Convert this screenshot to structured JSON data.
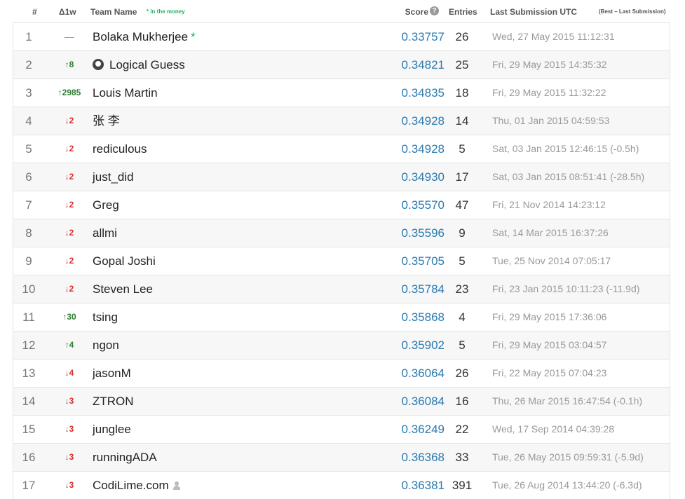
{
  "header": {
    "rank": "#",
    "delta": "Δ1w",
    "team": "Team Name",
    "money_note": "* in the money",
    "score": "Score",
    "help_icon": "?",
    "entries": "Entries",
    "last": "Last Submission UTC",
    "last_note": "(Best – Last Submission)"
  },
  "rows": [
    {
      "rank": "1",
      "delta": "—",
      "dir": "same",
      "team": "Bolaka Mukherjee",
      "star": "*",
      "score": "0.33757",
      "entries": "26",
      "last": "Wed, 27 May 2015 11:12:31"
    },
    {
      "rank": "2",
      "delta": "↑8",
      "dir": "up",
      "team": "Logical Guess",
      "github": true,
      "score": "0.34821",
      "entries": "25",
      "last": "Fri, 29 May 2015 14:35:32"
    },
    {
      "rank": "3",
      "delta": "↑2985",
      "dir": "up",
      "team": "Louis Martin",
      "score": "0.34835",
      "entries": "18",
      "last": "Fri, 29 May 2015 11:32:22"
    },
    {
      "rank": "4",
      "delta": "↓2",
      "dir": "down",
      "team": "张 李",
      "score": "0.34928",
      "entries": "14",
      "last": "Thu, 01 Jan 2015 04:59:53"
    },
    {
      "rank": "5",
      "delta": "↓2",
      "dir": "down",
      "team": "rediculous",
      "score": "0.34928",
      "entries": "5",
      "last": "Sat, 03 Jan 2015 12:46:15 (-0.5h)"
    },
    {
      "rank": "6",
      "delta": "↓2",
      "dir": "down",
      "team": "just_did",
      "score": "0.34930",
      "entries": "17",
      "last": "Sat, 03 Jan 2015 08:51:41 (-28.5h)"
    },
    {
      "rank": "7",
      "delta": "↓2",
      "dir": "down",
      "team": "Greg",
      "score": "0.35570",
      "entries": "47",
      "last": "Fri, 21 Nov 2014 14:23:12"
    },
    {
      "rank": "8",
      "delta": "↓2",
      "dir": "down",
      "team": "allmi",
      "score": "0.35596",
      "entries": "9",
      "last": "Sat, 14 Mar 2015 16:37:26"
    },
    {
      "rank": "9",
      "delta": "↓2",
      "dir": "down",
      "team": "Gopal Joshi",
      "score": "0.35705",
      "entries": "5",
      "last": "Tue, 25 Nov 2014 07:05:17"
    },
    {
      "rank": "10",
      "delta": "↓2",
      "dir": "down",
      "team": "Steven Lee",
      "score": "0.35784",
      "entries": "23",
      "last": "Fri, 23 Jan 2015 10:11:23 (-11.9d)"
    },
    {
      "rank": "11",
      "delta": "↑30",
      "dir": "up",
      "team": "tsing",
      "score": "0.35868",
      "entries": "4",
      "last": "Fri, 29 May 2015 17:36:06"
    },
    {
      "rank": "12",
      "delta": "↑4",
      "dir": "up",
      "team": "ngon",
      "score": "0.35902",
      "entries": "5",
      "last": "Fri, 29 May 2015 03:04:57"
    },
    {
      "rank": "13",
      "delta": "↓4",
      "dir": "down",
      "team": "jasonM",
      "score": "0.36064",
      "entries": "26",
      "last": "Fri, 22 May 2015 07:04:23"
    },
    {
      "rank": "14",
      "delta": "↓3",
      "dir": "down",
      "team": "ZTRON",
      "score": "0.36084",
      "entries": "16",
      "last": "Thu, 26 Mar 2015 16:47:54 (-0.1h)"
    },
    {
      "rank": "15",
      "delta": "↓3",
      "dir": "down",
      "team": "junglee",
      "score": "0.36249",
      "entries": "22",
      "last": "Wed, 17 Sep 2014 04:39:28"
    },
    {
      "rank": "16",
      "delta": "↓3",
      "dir": "down",
      "team": "runningADA",
      "score": "0.36368",
      "entries": "33",
      "last": "Tue, 26 May 2015 09:59:31 (-5.9d)"
    },
    {
      "rank": "17",
      "delta": "↓3",
      "dir": "down",
      "team": "CodiLime.com",
      "person": true,
      "score": "0.36381",
      "entries": "391",
      "last": "Tue, 26 Aug 2014 13:44:20 (-6.3d)"
    }
  ]
}
